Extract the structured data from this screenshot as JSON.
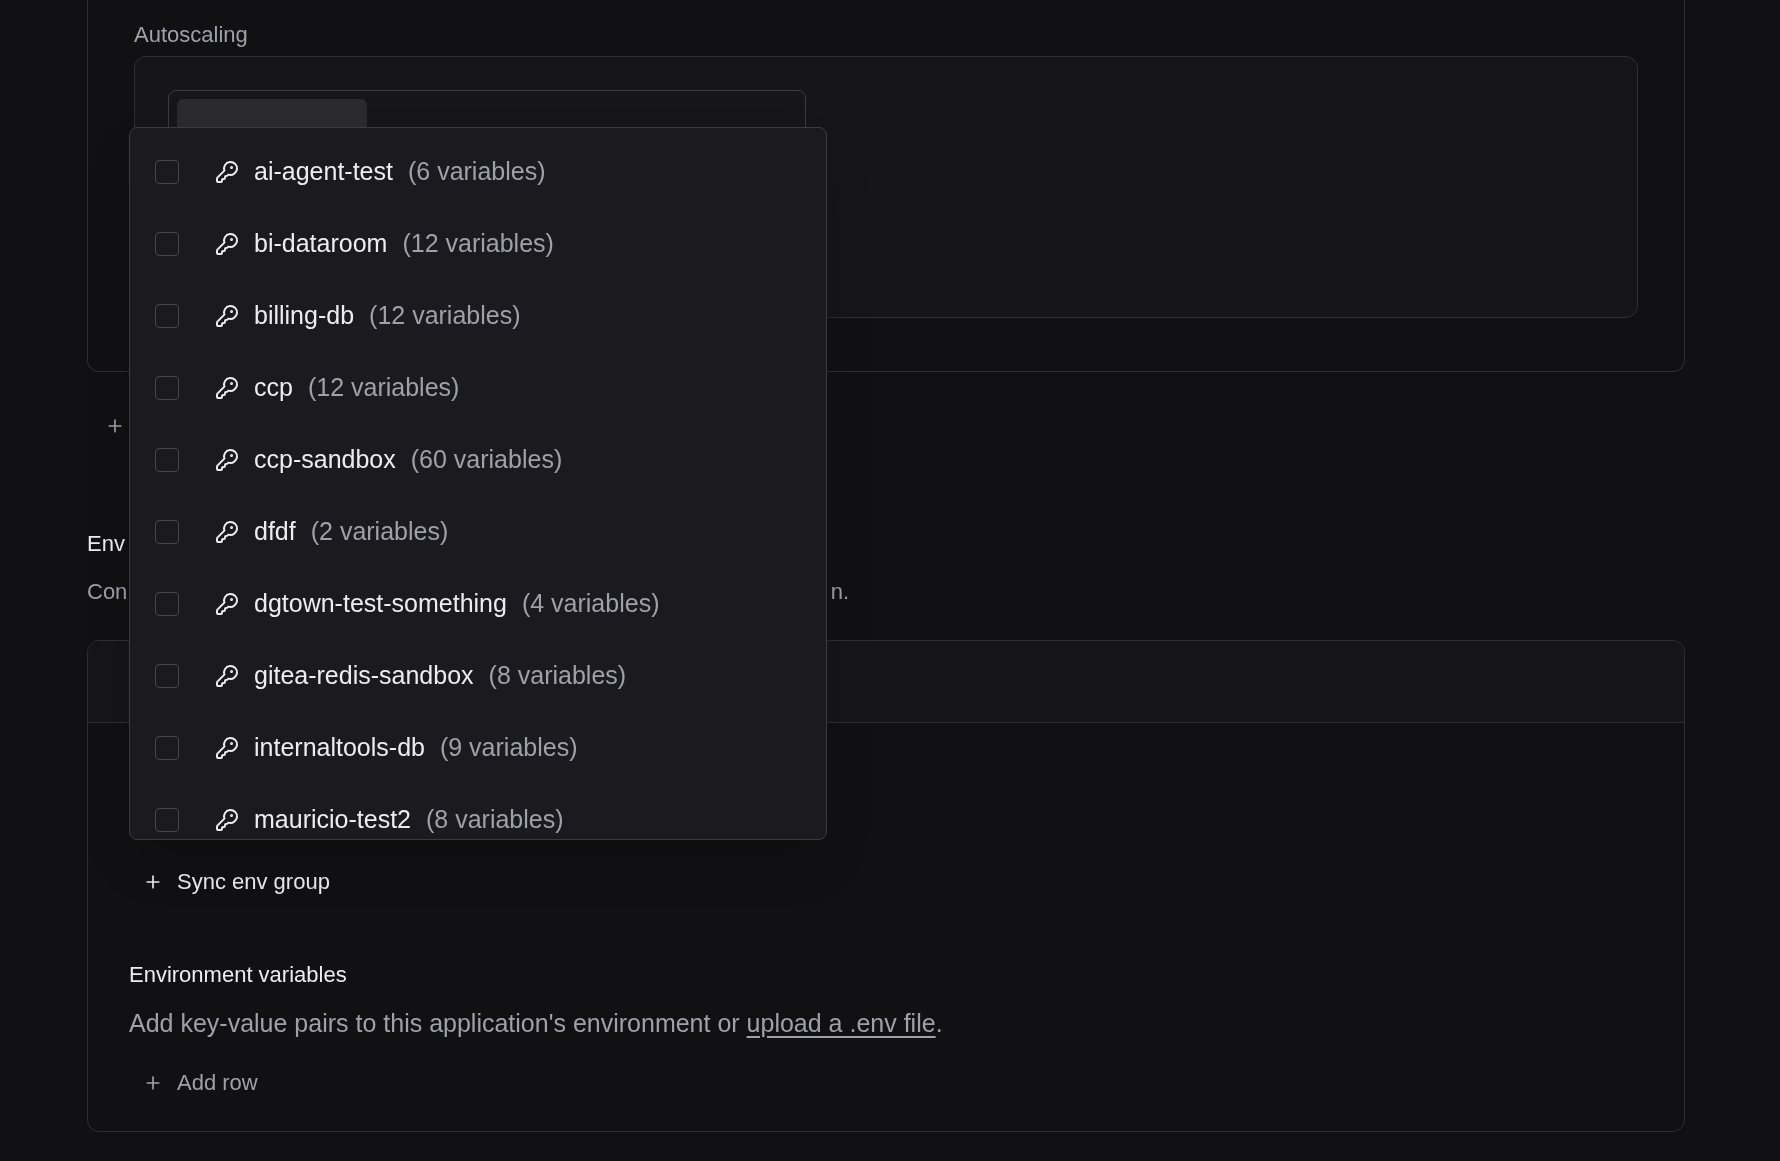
{
  "autoscaling": {
    "label": "Autoscaling"
  },
  "env_section": {
    "title_fragment": "Env",
    "description_fragments": [
      "Con",
      "n."
    ]
  },
  "env_group_menu": {
    "items": [
      {
        "name": "ai-agent-test",
        "count": "(6 variables)",
        "checked": false
      },
      {
        "name": "bi-dataroom",
        "count": "(12 variables)",
        "checked": false
      },
      {
        "name": "billing-db",
        "count": "(12 variables)",
        "checked": false
      },
      {
        "name": "ccp",
        "count": "(12 variables)",
        "checked": false
      },
      {
        "name": "ccp-sandbox",
        "count": "(60 variables)",
        "checked": false
      },
      {
        "name": "dfdf",
        "count": "(2 variables)",
        "checked": false
      },
      {
        "name": "dgtown-test-something",
        "count": "(4 variables)",
        "checked": false
      },
      {
        "name": "gitea-redis-sandbox",
        "count": "(8 variables)",
        "checked": false
      },
      {
        "name": "internaltools-db",
        "count": "(9 variables)",
        "checked": false
      },
      {
        "name": "mauricio-test2",
        "count": "(8 variables)",
        "checked": false
      }
    ]
  },
  "sync_button": "Sync env group",
  "env_vars": {
    "title": "Environment variables",
    "description": "Add key-value pairs to this application's environment or ",
    "link": "upload a .env file",
    "after": ".",
    "add_row": "Add row"
  }
}
